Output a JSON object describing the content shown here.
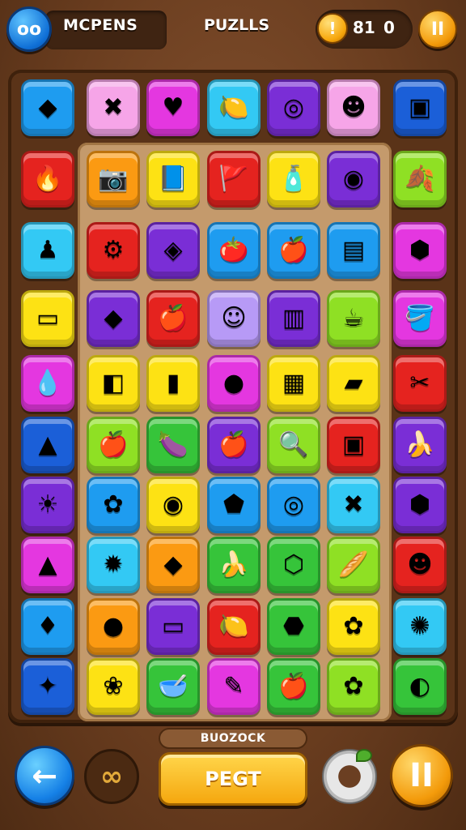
{
  "header": {
    "title": "MCPENS",
    "subtitle": "PUZLLS",
    "score_a": "81",
    "score_b": "0",
    "coin_glyph": "!",
    "pause_glyph": "II",
    "avatar_glyph": "oo"
  },
  "footer": {
    "label": "BUOZOCK",
    "main_button": "PEGT",
    "back_glyph": "←",
    "link_glyph": "∞",
    "pause_glyph": "II"
  },
  "colors": {
    "blue": "#1e9cf0",
    "pink": "#f6a5e8",
    "magenta": "#e437e0",
    "cyan": "#33c9f4",
    "purple": "#7a2ed6",
    "red": "#e5231f",
    "orange": "#fb9a12",
    "yellow": "#fde214",
    "green": "#36c43a",
    "lime": "#8fe024",
    "lavender": "#b79af6",
    "darkblue": "#1b5fd8"
  },
  "board": {
    "rows": [
      [
        {
          "color": "blue",
          "icon": "◆",
          "name": "blue-diamond-tile"
        },
        {
          "color": "pink",
          "icon": "✖",
          "name": "pink-x-tile"
        },
        {
          "color": "magenta",
          "icon": "♥",
          "name": "magenta-heart-tile"
        },
        {
          "color": "cyan",
          "icon": "🍋",
          "name": "cyan-lemon-tile"
        },
        {
          "color": "purple",
          "icon": "◎",
          "name": "purple-ring-tile"
        },
        {
          "color": "pink",
          "icon": "☻",
          "name": "pink-face-tile"
        },
        {
          "color": "darkblue",
          "icon": "▣",
          "name": "blue-box-tile"
        }
      ],
      [
        {
          "color": "red",
          "icon": "🔥",
          "name": "red-fire-tile"
        },
        {
          "color": "orange",
          "icon": "📷",
          "name": "orange-camera-tile"
        },
        {
          "color": "yellow",
          "icon": "📘",
          "name": "yellow-book-tile"
        },
        {
          "color": "red",
          "icon": "🚩",
          "name": "red-flag-tile"
        },
        {
          "color": "yellow",
          "icon": "🧴",
          "name": "yellow-bottle-tile"
        },
        {
          "color": "purple",
          "icon": "◉",
          "name": "purple-dial-tile"
        },
        {
          "color": "lime",
          "icon": "🍂",
          "name": "lime-leaf-tile"
        }
      ],
      [
        {
          "color": "cyan",
          "icon": "♟",
          "name": "cyan-pawn-tile"
        },
        {
          "color": "red",
          "icon": "⚙",
          "name": "red-gear-tile"
        },
        {
          "color": "purple",
          "icon": "◈",
          "name": "purple-gem-tile"
        },
        {
          "color": "blue",
          "icon": "🍅",
          "name": "blue-tomato-tile"
        },
        {
          "color": "blue",
          "icon": "🍎",
          "name": "blue-apple-tile"
        },
        {
          "color": "blue",
          "icon": "▤",
          "name": "blue-card-tile"
        },
        {
          "color": "magenta",
          "icon": "⬢",
          "name": "magenta-hex-tile"
        }
      ],
      [
        {
          "color": "yellow",
          "icon": "▭",
          "name": "yellow-screen-tile"
        },
        {
          "color": "purple",
          "icon": "◆",
          "name": "purple-sign-tile"
        },
        {
          "color": "red",
          "icon": "🍎",
          "name": "red-apple-tile"
        },
        {
          "color": "lavender",
          "icon": "☺",
          "name": "lavender-face-tile"
        },
        {
          "color": "purple",
          "icon": "▥",
          "name": "purple-jar-tile"
        },
        {
          "color": "lime",
          "icon": "☕",
          "name": "lime-cup-tile"
        },
        {
          "color": "magenta",
          "icon": "🪣",
          "name": "magenta-bucket-tile"
        }
      ],
      [
        {
          "color": "magenta",
          "icon": "💧",
          "name": "magenta-drop-tile"
        },
        {
          "color": "yellow",
          "icon": "◧",
          "name": "yellow-cube-tile"
        },
        {
          "color": "yellow",
          "icon": "▮",
          "name": "yellow-battery-tile"
        },
        {
          "color": "magenta",
          "icon": "●",
          "name": "magenta-ball-tile"
        },
        {
          "color": "yellow",
          "icon": "▦",
          "name": "yellow-window-tile"
        },
        {
          "color": "yellow",
          "icon": "▰",
          "name": "yellow-box-tile"
        },
        {
          "color": "red",
          "icon": "✂",
          "name": "red-tool-tile"
        }
      ],
      [
        {
          "color": "darkblue",
          "icon": "▲",
          "name": "blue-shape-tile"
        },
        {
          "color": "lime",
          "icon": "🍎",
          "name": "lime-apple-tile"
        },
        {
          "color": "green",
          "icon": "🍆",
          "name": "green-eggplant-tile"
        },
        {
          "color": "purple",
          "icon": "🍎",
          "name": "purple-apple-tile"
        },
        {
          "color": "lime",
          "icon": "🔍",
          "name": "lime-search-tile"
        },
        {
          "color": "red",
          "icon": "▣",
          "name": "red-device-tile"
        },
        {
          "color": "purple",
          "icon": "🍌",
          "name": "purple-banana-tile"
        }
      ],
      [
        {
          "color": "purple",
          "icon": "☀",
          "name": "purple-sun-tile"
        },
        {
          "color": "blue",
          "icon": "✿",
          "name": "blue-flower-tile"
        },
        {
          "color": "yellow",
          "icon": "◉",
          "name": "yellow-target-tile"
        },
        {
          "color": "blue",
          "icon": "⬟",
          "name": "blue-leaf-tile"
        },
        {
          "color": "blue",
          "icon": "◎",
          "name": "blue-donut-tile"
        },
        {
          "color": "cyan",
          "icon": "✖",
          "name": "cyan-cross-tile"
        },
        {
          "color": "purple",
          "icon": "⬢",
          "name": "purple-nut-tile"
        }
      ],
      [
        {
          "color": "magenta",
          "icon": "▲",
          "name": "magenta-triangle-tile"
        },
        {
          "color": "cyan",
          "icon": "✹",
          "name": "cyan-gear-tile"
        },
        {
          "color": "orange",
          "icon": "◆",
          "name": "orange-gem-tile"
        },
        {
          "color": "green",
          "icon": "🍌",
          "name": "green-banana-tile"
        },
        {
          "color": "green",
          "icon": "⬡",
          "name": "green-box-tile"
        },
        {
          "color": "lime",
          "icon": "🥖",
          "name": "lime-bread-tile"
        },
        {
          "color": "red",
          "icon": "☻",
          "name": "red-face-tile"
        }
      ],
      [
        {
          "color": "blue",
          "icon": "♦",
          "name": "blue-swirl-tile"
        },
        {
          "color": "orange",
          "icon": "●",
          "name": "orange-ball-tile"
        },
        {
          "color": "purple",
          "icon": "▭",
          "name": "purple-camera-tile"
        },
        {
          "color": "red",
          "icon": "🍋",
          "name": "red-lemon-tile"
        },
        {
          "color": "green",
          "icon": "⬣",
          "name": "green-pot-tile"
        },
        {
          "color": "yellow",
          "icon": "✿",
          "name": "yellow-flower-tile"
        },
        {
          "color": "cyan",
          "icon": "✺",
          "name": "cyan-badge-tile"
        }
      ],
      [
        {
          "color": "darkblue",
          "icon": "✦",
          "name": "blue-star-tile"
        },
        {
          "color": "yellow",
          "icon": "❀",
          "name": "yellow-cog-tile"
        },
        {
          "color": "green",
          "icon": "🥣",
          "name": "green-bowl-tile"
        },
        {
          "color": "magenta",
          "icon": "✎",
          "name": "magenta-pencil-tile"
        },
        {
          "color": "green",
          "icon": "🍎",
          "name": "green-apple-tile"
        },
        {
          "color": "lime",
          "icon": "✿",
          "name": "lime-flower-tile"
        },
        {
          "color": "green",
          "icon": "◐",
          "name": "green-shield-tile"
        }
      ]
    ]
  }
}
